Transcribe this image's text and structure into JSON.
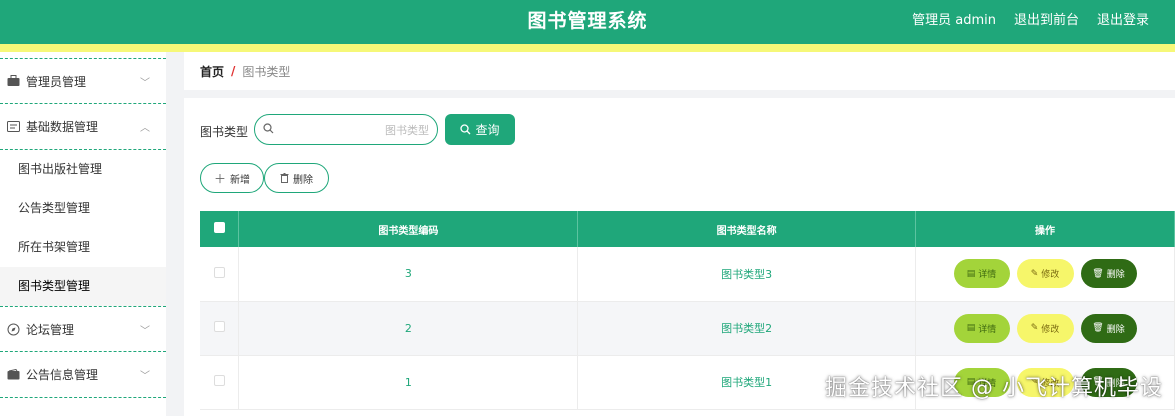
{
  "header": {
    "title": "图书管理系统",
    "admin_label": "管理员 admin",
    "front_link": "退出到前台",
    "logout_link": "退出登录"
  },
  "sidebar": {
    "groups": [
      {
        "label": "管理员管理",
        "icon": "briefcase-icon"
      },
      {
        "label": "基础数据管理",
        "icon": "card-icon"
      },
      {
        "label": "论坛管理",
        "icon": "compass-icon"
      },
      {
        "label": "公告信息管理",
        "icon": "wallet-icon"
      }
    ],
    "sub_items": [
      "图书出版社管理",
      "公告类型管理",
      "所在书架管理",
      "图书类型管理"
    ]
  },
  "breadcrumb": {
    "home": "首页",
    "separator": "/",
    "current": "图书类型"
  },
  "search": {
    "label": "图书类型",
    "placeholder": "图书类型",
    "button": "查询"
  },
  "actions": {
    "add": "新增",
    "delete": "删除"
  },
  "table": {
    "headers": [
      "图书类型编码",
      "图书类型名称",
      "操作"
    ],
    "rows": [
      {
        "code": "3",
        "name": "图书类型3"
      },
      {
        "code": "2",
        "name": "图书类型2"
      },
      {
        "code": "1",
        "name": "图书类型1"
      }
    ],
    "row_actions": {
      "detail": "详情",
      "edit": "修改",
      "delete": "删除"
    }
  },
  "watermark": "掘金技术社区 @ 小飞计算机毕设",
  "colors": {
    "primary": "#1fa77a",
    "accent_bar": "#f6f878",
    "detail": "#a3d43a",
    "edit": "#f6f66a",
    "delete": "#2f6b15"
  }
}
